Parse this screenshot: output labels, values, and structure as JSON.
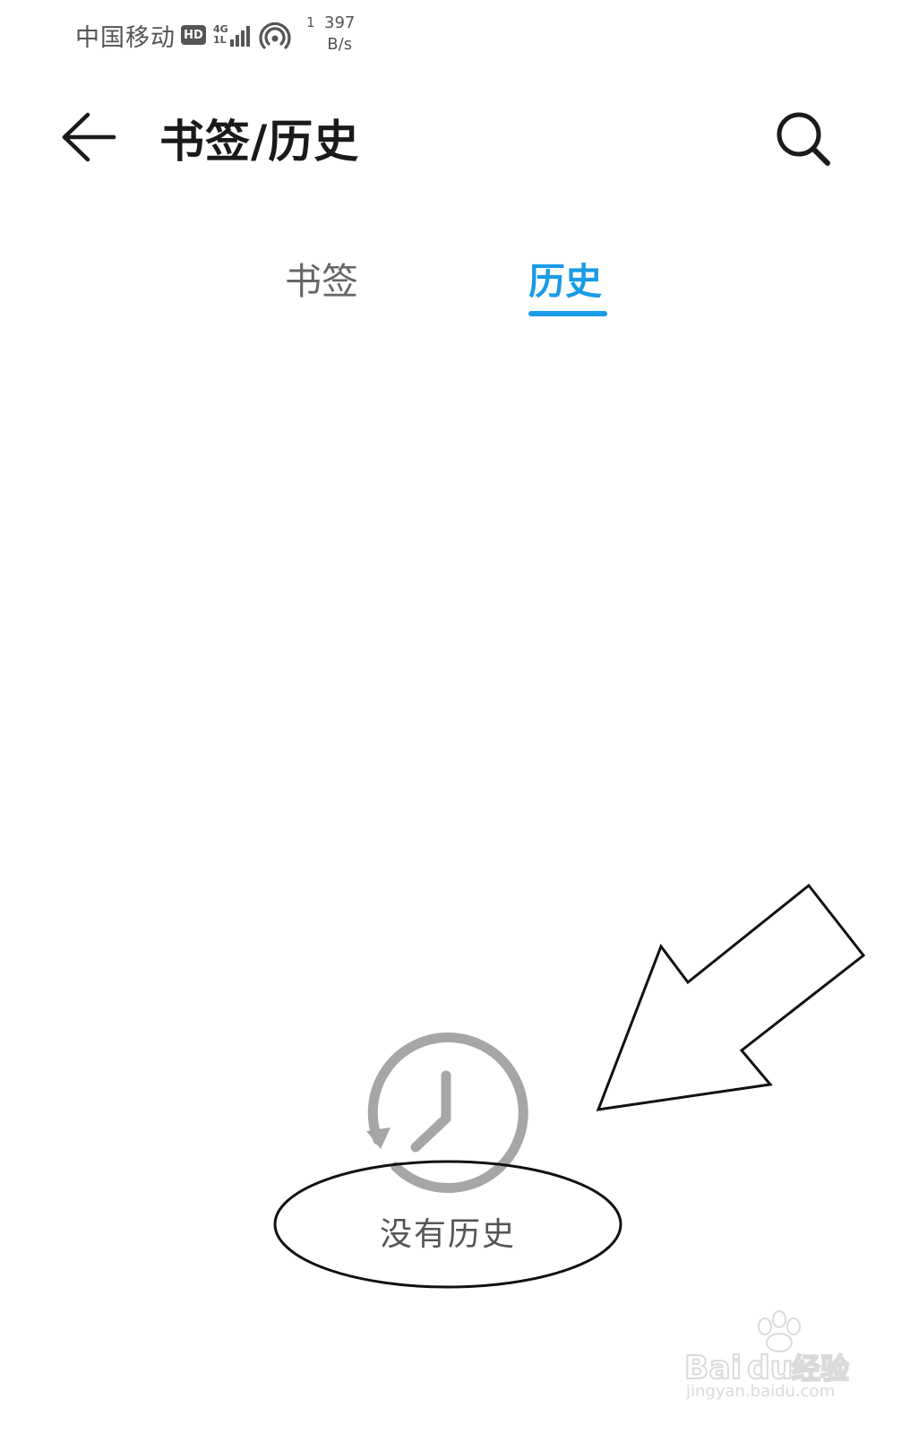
{
  "status_bar": {
    "carrier": "中国移动",
    "hd_label": "HD",
    "net_type_top": "4G",
    "net_type_bottom": "1L",
    "hotspot_count": "1",
    "speed_value": "397",
    "speed_unit": "B/s"
  },
  "header": {
    "title": "书签/历史",
    "back_icon": "arrow-left-icon",
    "search_icon": "search-icon"
  },
  "tabs": [
    {
      "label": "书签",
      "selected": false
    },
    {
      "label": "历史",
      "selected": true
    }
  ],
  "accent_color": "#1a9be6",
  "empty_state": {
    "icon": "history-clock-icon",
    "text": "没有历史"
  },
  "watermark": {
    "brand": "Baidu经验",
    "url": "jingyan.baidu.com"
  }
}
